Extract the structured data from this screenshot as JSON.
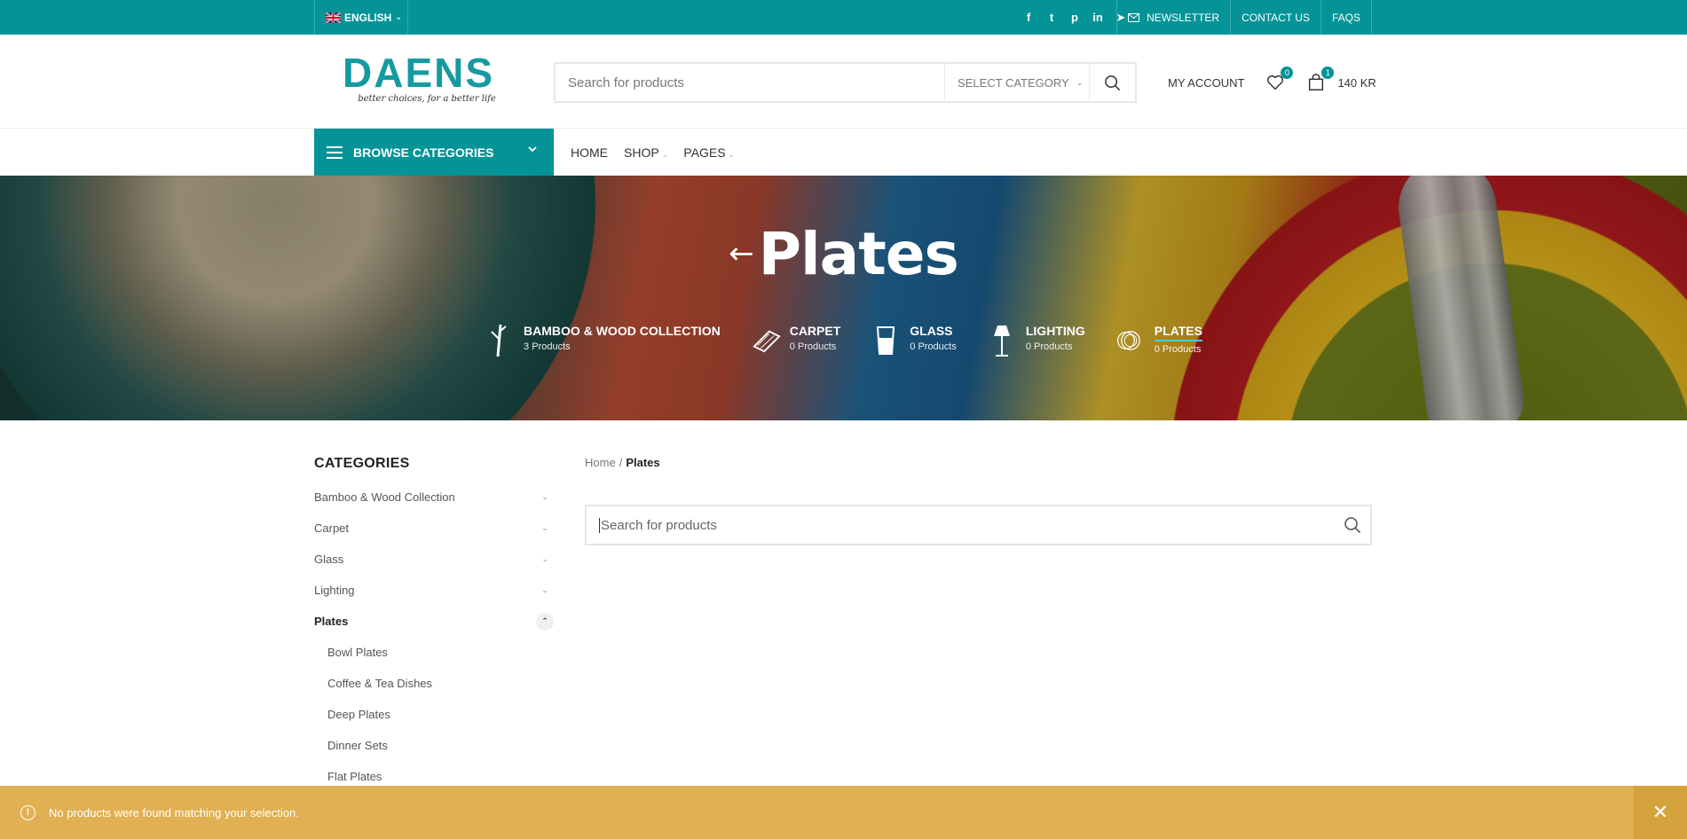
{
  "topbar": {
    "language": "ENGLISH",
    "socials": [
      {
        "icon": "facebook-icon",
        "glyph": "f"
      },
      {
        "icon": "twitter-icon",
        "glyph": "t"
      },
      {
        "icon": "pinterest-icon",
        "glyph": "p"
      },
      {
        "icon": "linkedin-icon",
        "glyph": "in"
      },
      {
        "icon": "telegram-icon",
        "glyph": "➤"
      }
    ],
    "newsletter": "NEWSLETTER",
    "contact": "CONTACT US",
    "faqs": "FAQS"
  },
  "header": {
    "logo": "DAENS",
    "tagline": "better choices, for a better life",
    "search_placeholder": "Search for products",
    "select_category": "SELECT CATEGORY",
    "my_account": "MY ACCOUNT",
    "wishlist_count": "0",
    "cart_count": "1",
    "cart_total": "140 KR"
  },
  "nav": {
    "browse": "BROWSE CATEGORIES",
    "home": "HOME",
    "shop": "SHOP",
    "pages": "PAGES"
  },
  "hero": {
    "back_arrow": "←",
    "title": "Plates",
    "categories": [
      {
        "name": "BAMBOO & WOOD COLLECTION",
        "count": "3 Products"
      },
      {
        "name": "CARPET",
        "count": "0 Products"
      },
      {
        "name": "GLASS",
        "count": "0 Products"
      },
      {
        "name": "LIGHTING",
        "count": "0 Products"
      },
      {
        "name": "PLATES",
        "count": "0 Products"
      }
    ]
  },
  "sidebar": {
    "title": "CATEGORIES",
    "items": [
      "Bamboo & Wood Collection",
      "Carpet",
      "Glass",
      "Lighting",
      "Plates"
    ],
    "subitems": [
      "Bowl Plates",
      "Coffee & Tea Dishes",
      "Deep Plates",
      "Dinner Sets",
      "Flat Plates"
    ]
  },
  "main": {
    "breadcrumb_home": "Home",
    "breadcrumb_sep": "/",
    "breadcrumb_current": "Plates",
    "search_placeholder": "Search for products"
  },
  "notice": {
    "icon": "!",
    "text": "No products were found matching your selection.",
    "close": "✕"
  },
  "colors": {
    "primary": "#049497",
    "notice": "#e0b052"
  }
}
